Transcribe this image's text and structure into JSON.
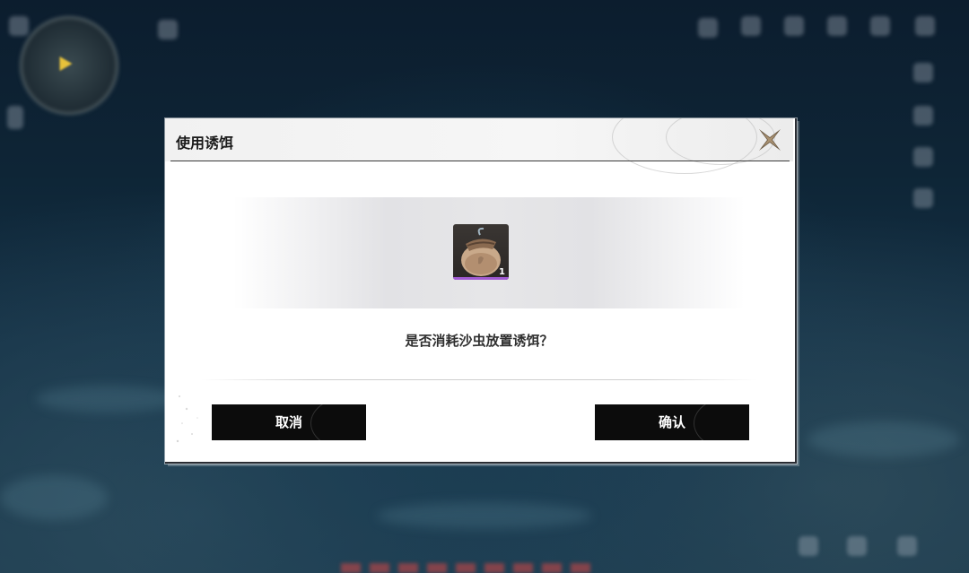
{
  "dialog": {
    "title": "使用诱饵",
    "question": "是否消耗沙虫放置诱饵？",
    "item": {
      "icon": "sandworm-bait-bag-icon",
      "count": "1",
      "rarity_color": "#a05ad2"
    },
    "buttons": {
      "cancel_label": "取消",
      "confirm_label": "确认"
    }
  },
  "colors": {
    "button_bg": "#0c0c0c",
    "dialog_bg": "#ffffff",
    "title_text": "#1a1a1a",
    "close_icon": "#6b5a45"
  }
}
